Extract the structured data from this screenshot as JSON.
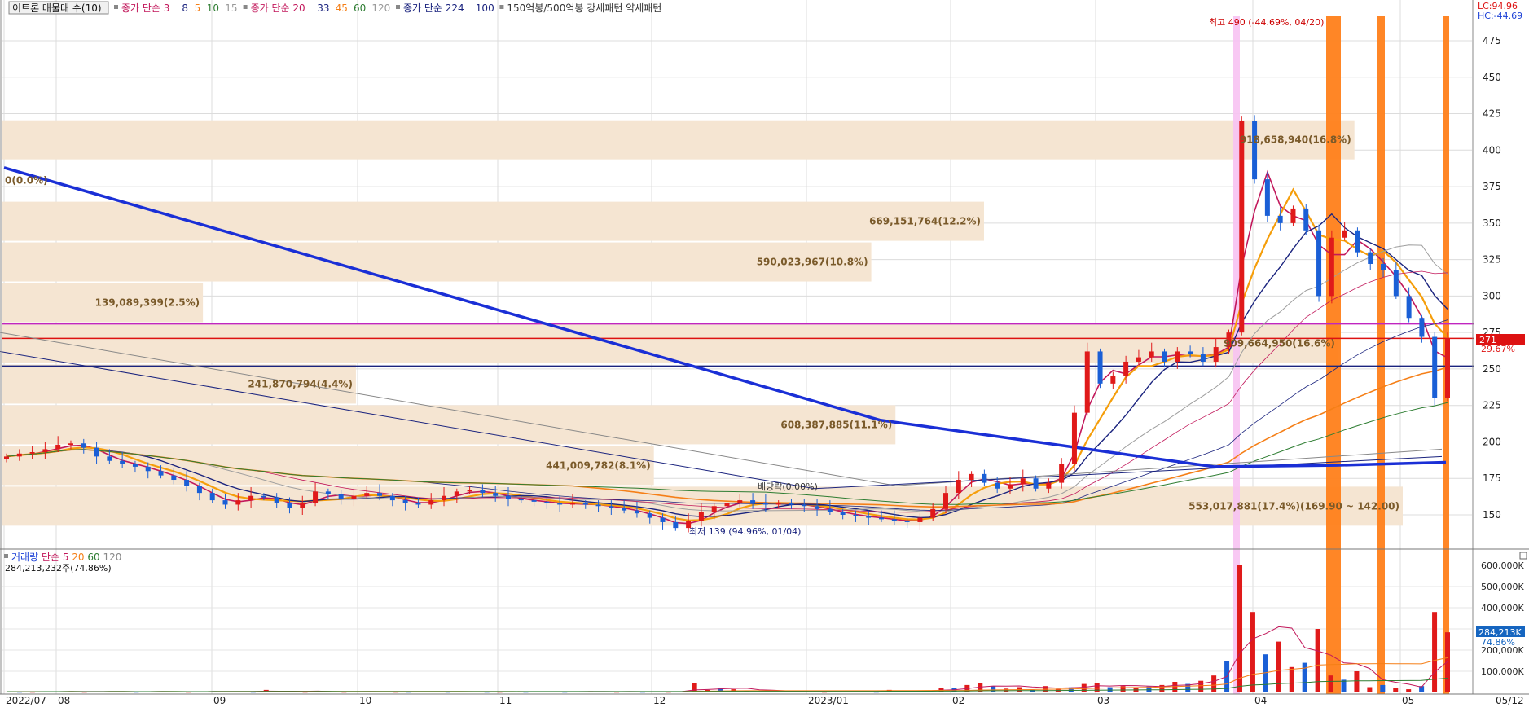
{
  "app": {
    "title_button": "이트론 매물대 수(10)",
    "legend_items": [
      {
        "text": "종가 단순 3",
        "color": "#c2185b"
      },
      {
        "text": "8",
        "color": "#1a237e"
      },
      {
        "text": "5",
        "color": "#f57f17"
      },
      {
        "text": "10",
        "color": "#2e7d32"
      },
      {
        "text": "15",
        "color": "#999999"
      },
      {
        "text": "종가 단순 20",
        "color": "#c2185b"
      },
      {
        "text": "33",
        "color": "#1a237e"
      },
      {
        "text": "45",
        "color": "#f57f17"
      },
      {
        "text": "60",
        "color": "#2e7d32"
      },
      {
        "text": "120",
        "color": "#999999"
      },
      {
        "text": "종가 단순 224",
        "color": "#1a237e"
      },
      {
        "text": "100",
        "color": "#1a237e"
      },
      {
        "text": "150억봉/500억봉 강세패턴  약세패턴",
        "color": "#333333"
      }
    ],
    "lc_label": "LC:94.96",
    "hc_label": "HC:-44.69"
  },
  "chart_data": [
    {
      "type": "candlestick",
      "title": "이트론 매물대 수(10)",
      "ylim": [
        128,
        490
      ],
      "y_ticks": [
        150,
        175,
        200,
        225,
        250,
        275,
        300,
        325,
        350,
        375,
        400,
        425,
        450,
        475
      ],
      "x_ticks": [
        "2022/07",
        "08",
        "09",
        "10",
        "11",
        "12",
        "2023/01",
        "02",
        "03",
        "04",
        "05",
        "05/12"
      ],
      "current_price_label": "271",
      "current_pct_label": "29.67%",
      "annotations": {
        "high": "최고 490 (-44.69%, 04/20)",
        "low": "최저 139 (94.96%, 01/04)",
        "ex_div": "배당락(0.00%)",
        "zero_vp": "0(0.0%)"
      },
      "volume_profile": [
        {
          "label": "553,017,881(17.4%)(169.90 ~ 142.00)",
          "low": 142,
          "high": 169.9,
          "pct": 17.4
        },
        {
          "label": "441,009,782(8.1%)",
          "low": 169.9,
          "high": 197.8,
          "pct": 8.1
        },
        {
          "label": "608,387,885(11.1%)",
          "low": 197.8,
          "high": 225.7,
          "pct": 11.1
        },
        {
          "label": "241,870,794(4.4%)",
          "low": 225.7,
          "high": 253.6,
          "pct": 4.4
        },
        {
          "label": "909,664,950(16.6%)",
          "low": 253.6,
          "high": 281.5,
          "pct": 16.6
        },
        {
          "label": "139,089,399(2.5%)",
          "low": 281.5,
          "high": 309.4,
          "pct": 2.5
        },
        {
          "label": "590,023,967(10.8%)",
          "low": 309.4,
          "high": 337.3,
          "pct": 10.8
        },
        {
          "label": "669,151,764(12.2%)",
          "low": 337.3,
          "high": 365.2,
          "pct": 12.2
        },
        {
          "label": "0(0.0%)",
          "low": 365.2,
          "high": 393.1,
          "pct": 0
        },
        {
          "label": "918,658,940(16.8%)",
          "low": 393.1,
          "high": 421.0,
          "pct": 16.8
        }
      ],
      "horizontal_lines": [
        {
          "value": 281,
          "color": "#c026c0"
        },
        {
          "value": 271,
          "color": "#dd1111"
        },
        {
          "value": 252,
          "color": "#1a237e"
        }
      ],
      "trend_line": {
        "from": [
          0,
          388
        ],
        "to": [
          1,
          185
        ],
        "color": "#1a2fd6"
      },
      "price_series": [
        [
          188,
          190
        ],
        [
          190,
          192
        ],
        [
          192,
          193
        ],
        [
          193,
          195
        ],
        [
          195,
          198
        ],
        [
          198,
          199
        ],
        [
          199,
          196
        ],
        [
          196,
          190
        ],
        [
          190,
          187
        ],
        [
          187,
          185
        ],
        [
          185,
          183
        ],
        [
          183,
          180
        ],
        [
          180,
          177
        ],
        [
          177,
          174
        ],
        [
          174,
          170
        ],
        [
          170,
          165
        ],
        [
          165,
          160
        ],
        [
          160,
          157
        ],
        [
          157,
          160
        ],
        [
          160,
          163
        ],
        [
          163,
          162
        ],
        [
          162,
          158
        ],
        [
          158,
          155
        ],
        [
          155,
          158
        ],
        [
          158,
          166
        ],
        [
          166,
          164
        ],
        [
          164,
          161
        ],
        [
          161,
          163
        ],
        [
          163,
          165
        ],
        [
          165,
          163
        ],
        [
          163,
          160
        ],
        [
          160,
          158
        ],
        [
          158,
          157
        ],
        [
          157,
          160
        ],
        [
          160,
          163
        ],
        [
          163,
          166
        ],
        [
          166,
          167
        ],
        [
          167,
          165
        ],
        [
          165,
          163
        ],
        [
          163,
          161
        ],
        [
          161,
          160
        ],
        [
          160,
          159
        ],
        [
          159,
          158
        ],
        [
          158,
          157
        ],
        [
          157,
          158
        ],
        [
          158,
          157
        ],
        [
          157,
          156
        ],
        [
          156,
          155
        ],
        [
          155,
          153
        ],
        [
          153,
          151
        ],
        [
          151,
          148
        ],
        [
          148,
          145
        ],
        [
          145,
          141
        ],
        [
          141,
          146
        ],
        [
          146,
          152
        ],
        [
          152,
          156
        ],
        [
          156,
          158
        ],
        [
          158,
          160
        ],
        [
          160,
          158
        ],
        [
          158,
          157
        ],
        [
          157,
          158
        ],
        [
          158,
          157
        ],
        [
          157,
          156
        ],
        [
          156,
          154
        ],
        [
          154,
          152
        ],
        [
          152,
          150
        ],
        [
          150,
          149
        ],
        [
          149,
          148
        ],
        [
          148,
          147
        ],
        [
          147,
          146
        ],
        [
          146,
          145
        ],
        [
          145,
          148
        ],
        [
          148,
          154
        ],
        [
          154,
          165
        ],
        [
          165,
          174
        ],
        [
          174,
          178
        ],
        [
          178,
          172
        ],
        [
          172,
          168
        ],
        [
          168,
          171
        ],
        [
          171,
          175
        ],
        [
          175,
          168
        ],
        [
          168,
          172
        ],
        [
          172,
          185
        ],
        [
          185,
          220
        ],
        [
          220,
          262
        ],
        [
          262,
          240
        ],
        [
          240,
          245
        ],
        [
          245,
          255
        ],
        [
          255,
          258
        ],
        [
          258,
          262
        ],
        [
          262,
          255
        ],
        [
          255,
          262
        ],
        [
          262,
          260
        ],
        [
          260,
          255
        ],
        [
          255,
          265
        ],
        [
          265,
          275
        ],
        [
          275,
          420
        ],
        [
          420,
          380
        ],
        [
          380,
          355
        ],
        [
          355,
          350
        ],
        [
          350,
          360
        ],
        [
          360,
          345
        ],
        [
          345,
          300
        ],
        [
          300,
          340
        ],
        [
          340,
          345
        ],
        [
          345,
          330
        ],
        [
          330,
          322
        ],
        [
          322,
          318
        ],
        [
          318,
          300
        ],
        [
          300,
          285
        ],
        [
          285,
          272
        ],
        [
          272,
          230
        ],
        [
          230,
          271
        ]
      ]
    },
    {
      "type": "bar",
      "title": "거래량 단순 5 20 60 120",
      "subtitle": "284,213,232주(74.86%)",
      "y_ticks": [
        "100,000K",
        "200,000K",
        "300,000K",
        "400,000K",
        "500,000K",
        "600,000K"
      ],
      "ylim": [
        0,
        650000
      ],
      "last_value_label": "284,213K",
      "last_pct_label": "74.86%",
      "volume_series": [
        4,
        3,
        3,
        5,
        4,
        6,
        3,
        4,
        5,
        4,
        3,
        4,
        5,
        4,
        3,
        4,
        6,
        5,
        4,
        3,
        12,
        5,
        4,
        3,
        6,
        4,
        3,
        4,
        5,
        4,
        3,
        3,
        4,
        5,
        3,
        4,
        4,
        3,
        3,
        4,
        3,
        4,
        5,
        3,
        4,
        6,
        4,
        3,
        4,
        3,
        4,
        3,
        5,
        45,
        12,
        20,
        15,
        8,
        6,
        5,
        4,
        5,
        4,
        3,
        6,
        4,
        5,
        3,
        12,
        6,
        8,
        5,
        20,
        22,
        35,
        45,
        30,
        18,
        25,
        12,
        30,
        18,
        24,
        40,
        45,
        25,
        30,
        22,
        28,
        35,
        50,
        40,
        55,
        80,
        150,
        600,
        380,
        180,
        240,
        120,
        140,
        300,
        80,
        60,
        100,
        25,
        35,
        20,
        15,
        30,
        380,
        284
      ],
      "volume_colors_up": [
        true
      ]
    }
  ]
}
